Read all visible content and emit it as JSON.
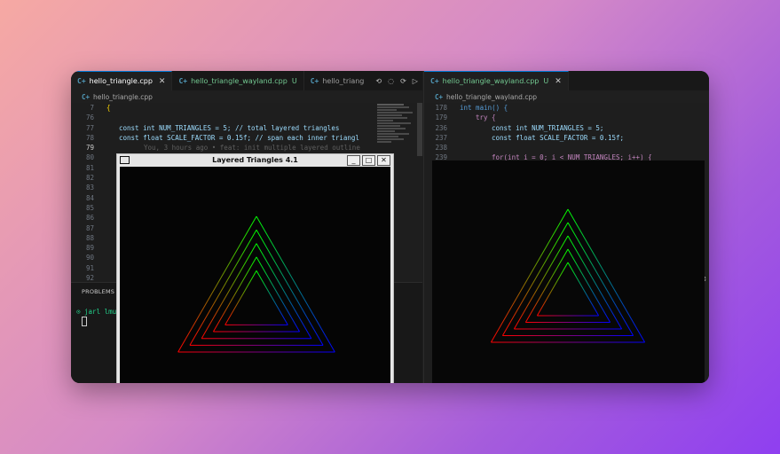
{
  "left_editor": {
    "tabs": [
      {
        "label": "hello_triangle.cpp",
        "active": true,
        "status": ""
      },
      {
        "label": "hello_triangle_wayland.cpp",
        "active": false,
        "status": "U"
      },
      {
        "label": "hello_triang",
        "active": false,
        "status": ""
      }
    ],
    "breadcrumb": "hello_triangle.cpp",
    "lines": [
      {
        "n": "7",
        "code": "{"
      },
      {
        "n": "76",
        "code": ""
      },
      {
        "n": "77",
        "code": "const int NUM_TRIANGLES = 5;  // total layered triangles"
      },
      {
        "n": "78",
        "code": "const float SCALE_FACTOR = 0.15f;  // span each inner triangl"
      },
      {
        "n": "79",
        "code": "You, 3 hours ago • feat: init multiple layered outline"
      },
      {
        "n": "80",
        "code": ""
      },
      {
        "n": "81",
        "code": ""
      },
      {
        "n": "82",
        "code": ""
      },
      {
        "n": "83",
        "code": ""
      },
      {
        "n": "84",
        "code": ""
      },
      {
        "n": "85",
        "code": ""
      },
      {
        "n": "86",
        "code": ""
      },
      {
        "n": "87",
        "code": ""
      },
      {
        "n": "88",
        "code": ""
      },
      {
        "n": "89",
        "code": ""
      },
      {
        "n": "90",
        "code": ""
      },
      {
        "n": "91",
        "code": ""
      },
      {
        "n": "92",
        "code": ""
      }
    ],
    "panel_tab": "PROBLEMS",
    "terminal_prompt": "⊙ jarl lmuh@"
  },
  "right_editor": {
    "tabs": [
      {
        "label": "hello_triangle_wayland.cpp",
        "status": "U"
      }
    ],
    "breadcrumb": "hello_triangle_wayland.cpp",
    "lines": [
      {
        "n": "178",
        "code": "int main() {"
      },
      {
        "n": "179",
        "code": "try {"
      },
      {
        "n": "236",
        "code": "const int NUM_TRIANGLES = 5;"
      },
      {
        "n": "237",
        "code": "const float SCALE_FACTOR = 0.15f;"
      },
      {
        "n": "238",
        "code": ""
      },
      {
        "n": "239",
        "code": "for(int i = 0; i < NUM_TRIANGLES; i++) {"
      }
    ]
  },
  "x11_window": {
    "title": "Layered Triangles 4.1",
    "buttons": [
      "_",
      "□",
      "✕"
    ]
  },
  "triangles": {
    "count": 5,
    "scale_factor": 0.15,
    "colors": {
      "top": "#00ff00",
      "left": "#ff0000",
      "right": "#0000ff"
    }
  },
  "colors": {
    "accent": "#0078d4",
    "editor_bg": "#1e1e1e",
    "untracked": "#73c991"
  }
}
